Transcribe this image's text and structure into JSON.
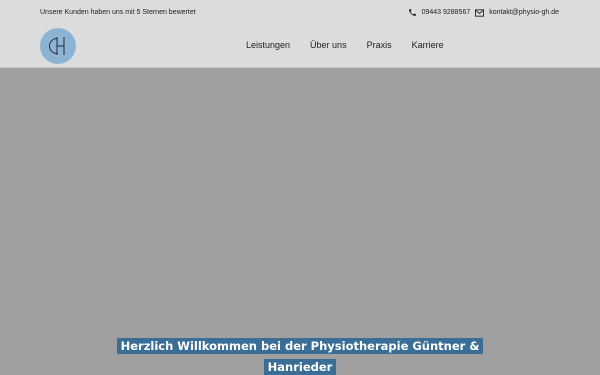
{
  "topbar": {
    "tagline": "Unsere Kunden haben uns mit 5 Sternen bewertet",
    "phone": "09443 9288567",
    "phone_icon": "phone-icon",
    "email": "kontakt@physio-gh.de",
    "email_icon": "mail-icon"
  },
  "logo": {
    "icon": "gh-monogram-logo",
    "color": "#8db3d4"
  },
  "nav": {
    "items": [
      {
        "label": "Leistungen"
      },
      {
        "label": "Über uns"
      },
      {
        "label": "Praxis"
      },
      {
        "label": "Karriere"
      }
    ]
  },
  "hero": {
    "title": "Herzlich Willkommen bei der Physiotherapie Güntner & Hanrieder",
    "title_bg": "#3a6e96"
  }
}
